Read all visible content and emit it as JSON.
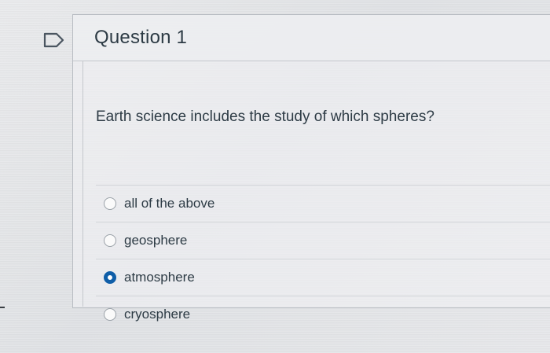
{
  "question": {
    "title": "Question 1",
    "prompt": "Earth science includes the study of which spheres?",
    "answers": [
      {
        "label": "all of the above",
        "selected": false
      },
      {
        "label": "geosphere",
        "selected": false
      },
      {
        "label": "atmosphere",
        "selected": true
      },
      {
        "label": "cryosphere",
        "selected": false
      }
    ]
  },
  "colors": {
    "selected_radio": "#0f5ea8",
    "text": "#2d3b45"
  },
  "icons": [
    "flag-question-icon"
  ]
}
